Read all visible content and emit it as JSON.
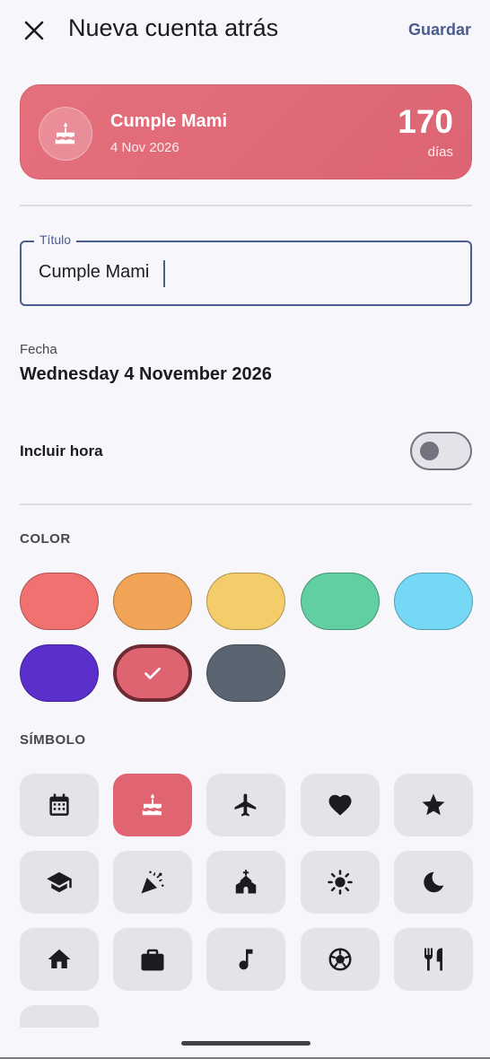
{
  "header": {
    "title": "Nueva cuenta atrás",
    "save_label": "Guardar",
    "close_icon": "close-icon"
  },
  "preview": {
    "name": "Cumple Mami",
    "date": "4 Nov 2026",
    "count": "170",
    "unit": "días",
    "icon": "cake-icon"
  },
  "title_field": {
    "label": "Título",
    "value": "Cumple Mami"
  },
  "date": {
    "label": "Fecha",
    "value": "Wednesday 4 November 2026"
  },
  "include_time": {
    "label": "Incluir hora",
    "enabled": false
  },
  "color_section": {
    "heading": "COLOR",
    "options": [
      {
        "name": "coral",
        "hex": "#f0716f"
      },
      {
        "name": "orange",
        "hex": "#f1a455"
      },
      {
        "name": "yellow",
        "hex": "#f5cc6a"
      },
      {
        "name": "green",
        "hex": "#61cfa1"
      },
      {
        "name": "sky",
        "hex": "#75d8f5"
      },
      {
        "name": "purple",
        "hex": "#5a2fcb"
      },
      {
        "name": "rose",
        "hex": "#df6471",
        "selected": true
      },
      {
        "name": "slate",
        "hex": "#5b6471"
      }
    ]
  },
  "symbol_section": {
    "heading": "SÍMBOLO",
    "icons": [
      "calendar-icon",
      "cake-icon",
      "airplane-icon",
      "heart-icon",
      "star-icon",
      "graduation-cap-icon",
      "party-popper-icon",
      "church-icon",
      "sun-icon",
      "moon-icon",
      "home-icon",
      "briefcase-icon",
      "music-note-icon",
      "soccer-ball-icon",
      "restaurant-icon",
      "tv-icon"
    ],
    "selected": "cake-icon"
  }
}
